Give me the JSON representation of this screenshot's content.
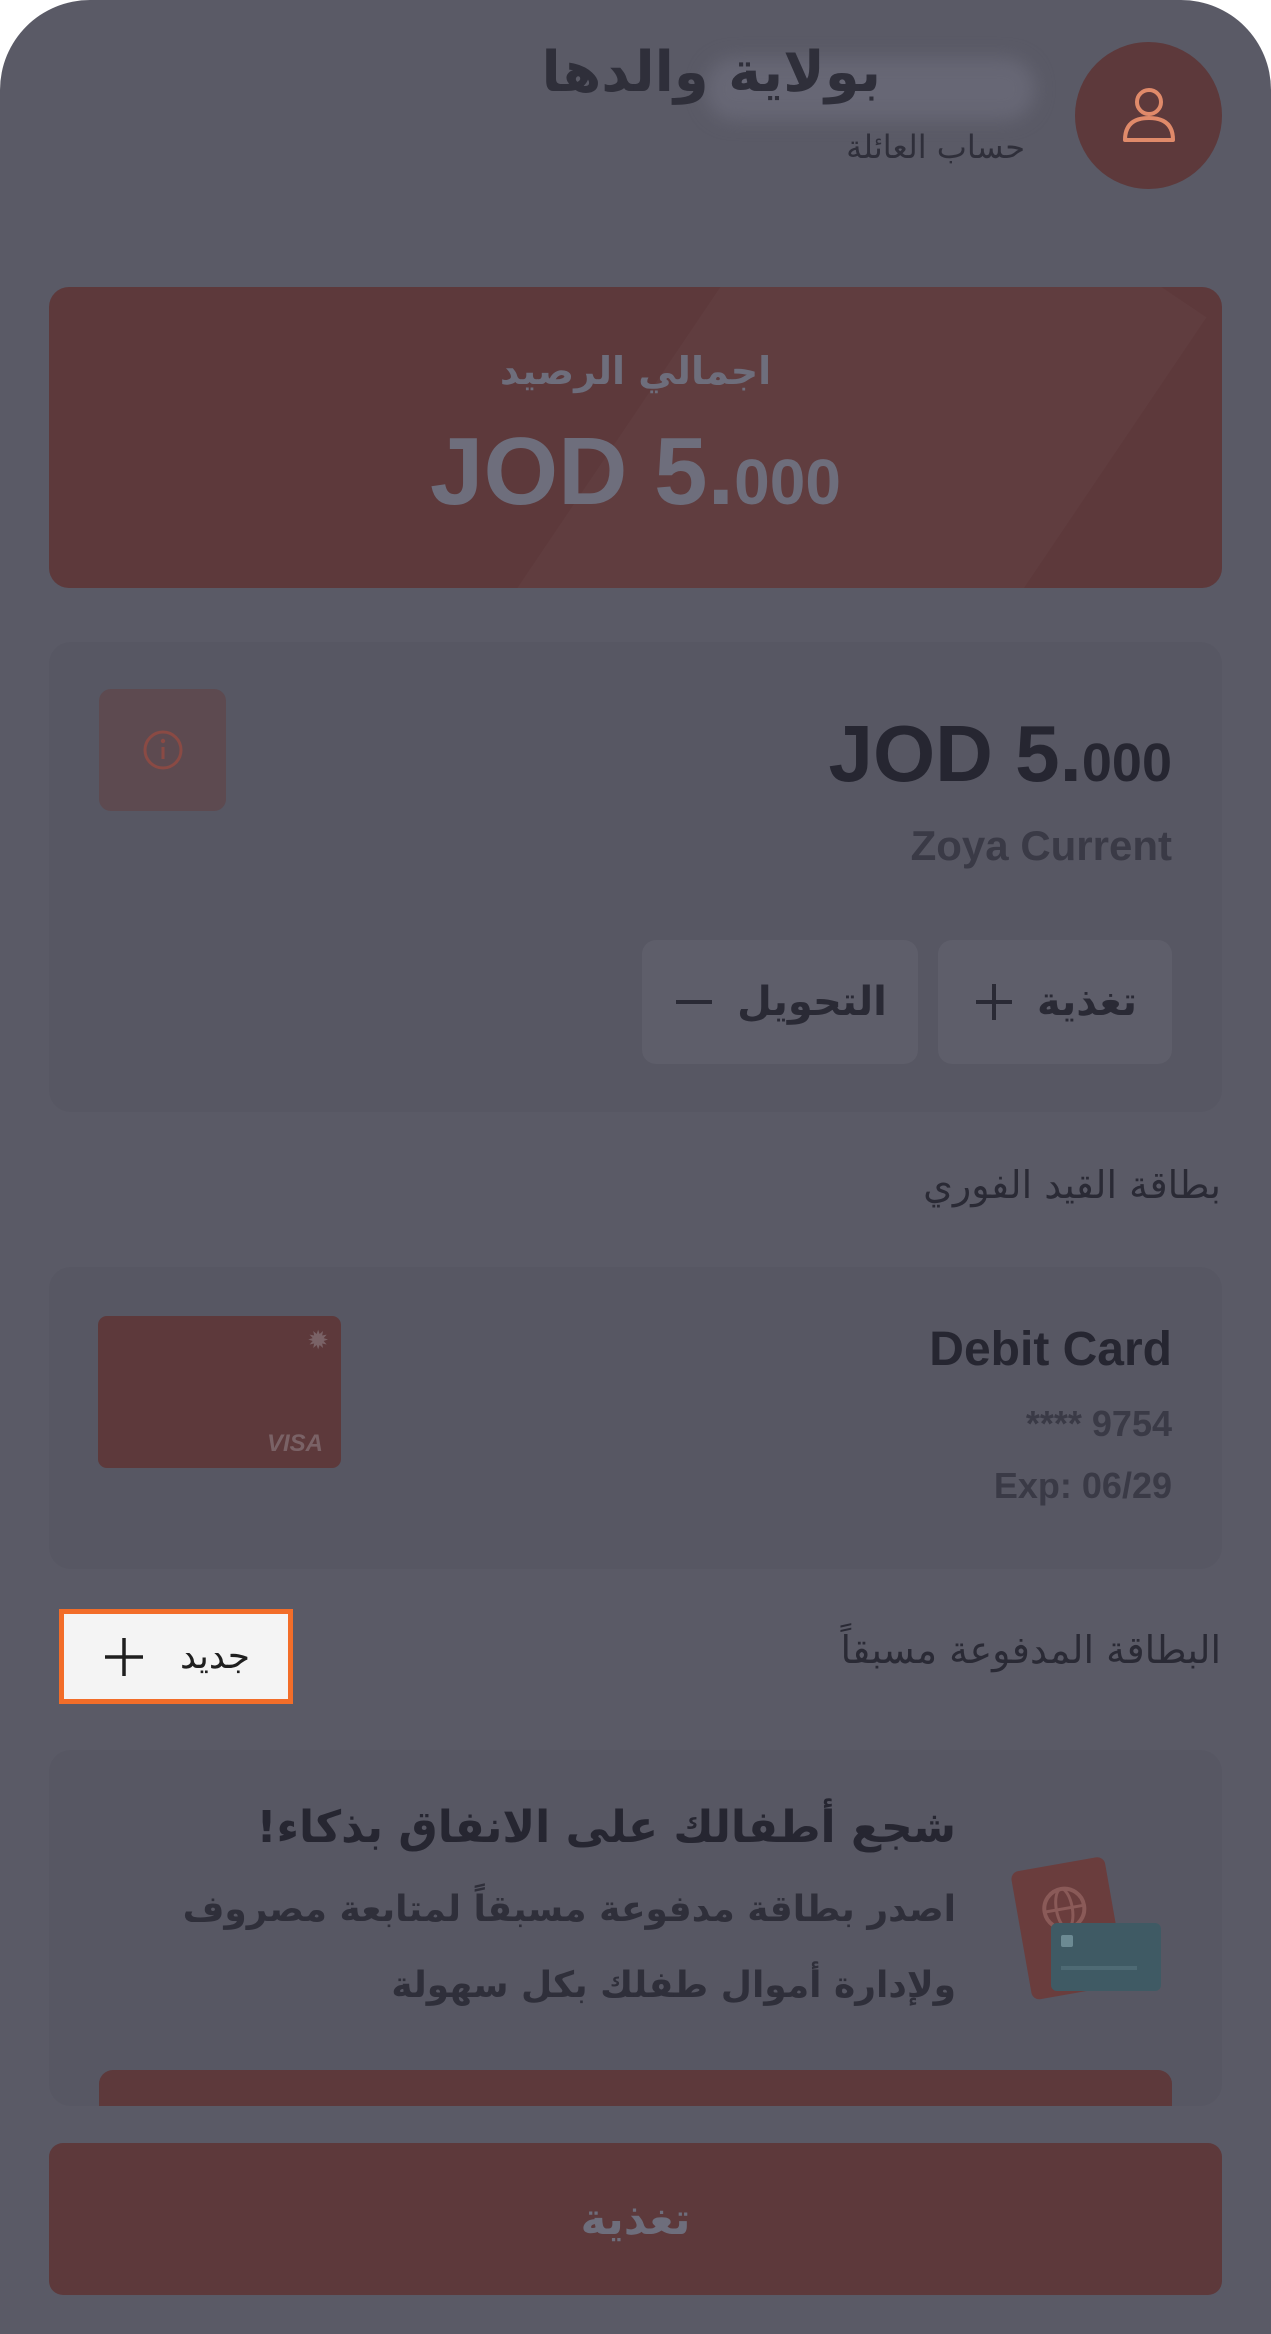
{
  "header": {
    "title": "بولاية والدها",
    "subtitle": "حساب العائلة"
  },
  "total_balance": {
    "label": "اجمالي الرصيد",
    "amount_int": "JOD 5.",
    "amount_dec": "000"
  },
  "account": {
    "amount_int": "JOD 5.",
    "amount_dec": "000",
    "name": "Zoya Current",
    "feed_label": "تغذية",
    "transfer_label": "التحويل"
  },
  "debit_section": {
    "label": "بطاقة القيد الفوري",
    "card_title": "Debit Card",
    "card_number": "**** 9754",
    "expiry": "Exp: 06/29",
    "card_brand": "VISA"
  },
  "prepaid_section": {
    "label": "البطاقة المدفوعة مسبقاً",
    "new_label": "جديد"
  },
  "promo": {
    "title": "شجع أطفالك على الانفاق بذكاء!",
    "body": "اصدر بطاقة مدفوعة مسبقاً لمتابعة مصروف ولإدارة أموال طفلك بكل سهولة"
  },
  "bottom_button": {
    "label": "تغذية"
  },
  "colors": {
    "overlay": "#5a5a66",
    "accent_dimmed": "#5d393b",
    "highlight_border": "#f26d29"
  },
  "icons": [
    "user-icon",
    "info-icon",
    "plus-icon",
    "minus-icon",
    "gear-icon",
    "globe-icon"
  ]
}
